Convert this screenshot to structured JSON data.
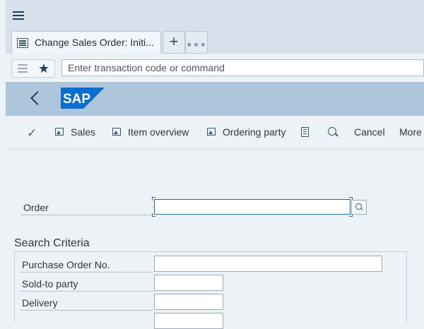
{
  "header": {
    "menu_icon": "hamburger-menu-icon"
  },
  "tabs": {
    "active_title": "Change Sales Order: Initi...",
    "active_icon": "document-list-icon",
    "new_tab_label": "+",
    "more_label": "∘∘∘"
  },
  "command": {
    "placeholder": "Enter transaction code or command",
    "value": ""
  },
  "shell": {
    "logo_text": "SAP",
    "logo_color": "#0a6ed1",
    "back_icon": "back-chevron-icon"
  },
  "toolbar": {
    "items": [
      {
        "label": "Sales",
        "icon": "image-icon"
      },
      {
        "label": "Item overview",
        "icon": "image-icon"
      },
      {
        "label": "Ordering party",
        "icon": "image-icon"
      },
      {
        "label": "",
        "icon": "document-icon"
      },
      {
        "label": "",
        "icon": "magnifier-icon"
      },
      {
        "label": "Cancel",
        "icon": ""
      },
      {
        "label": "More",
        "icon": ""
      }
    ]
  },
  "form": {
    "order_label": "Order",
    "order_value": "",
    "search_criteria_title": "Search Criteria",
    "criteria": [
      {
        "label": "Purchase Order No.",
        "value": ""
      },
      {
        "label": "Sold-to party",
        "value": ""
      },
      {
        "label": "Delivery",
        "value": ""
      }
    ]
  },
  "colors": {
    "top_bar": "#d6e1ec",
    "shell_bar": "#adc6dc",
    "page_bg": "#edf2f7",
    "confirm_check": "#2b7d2b"
  }
}
